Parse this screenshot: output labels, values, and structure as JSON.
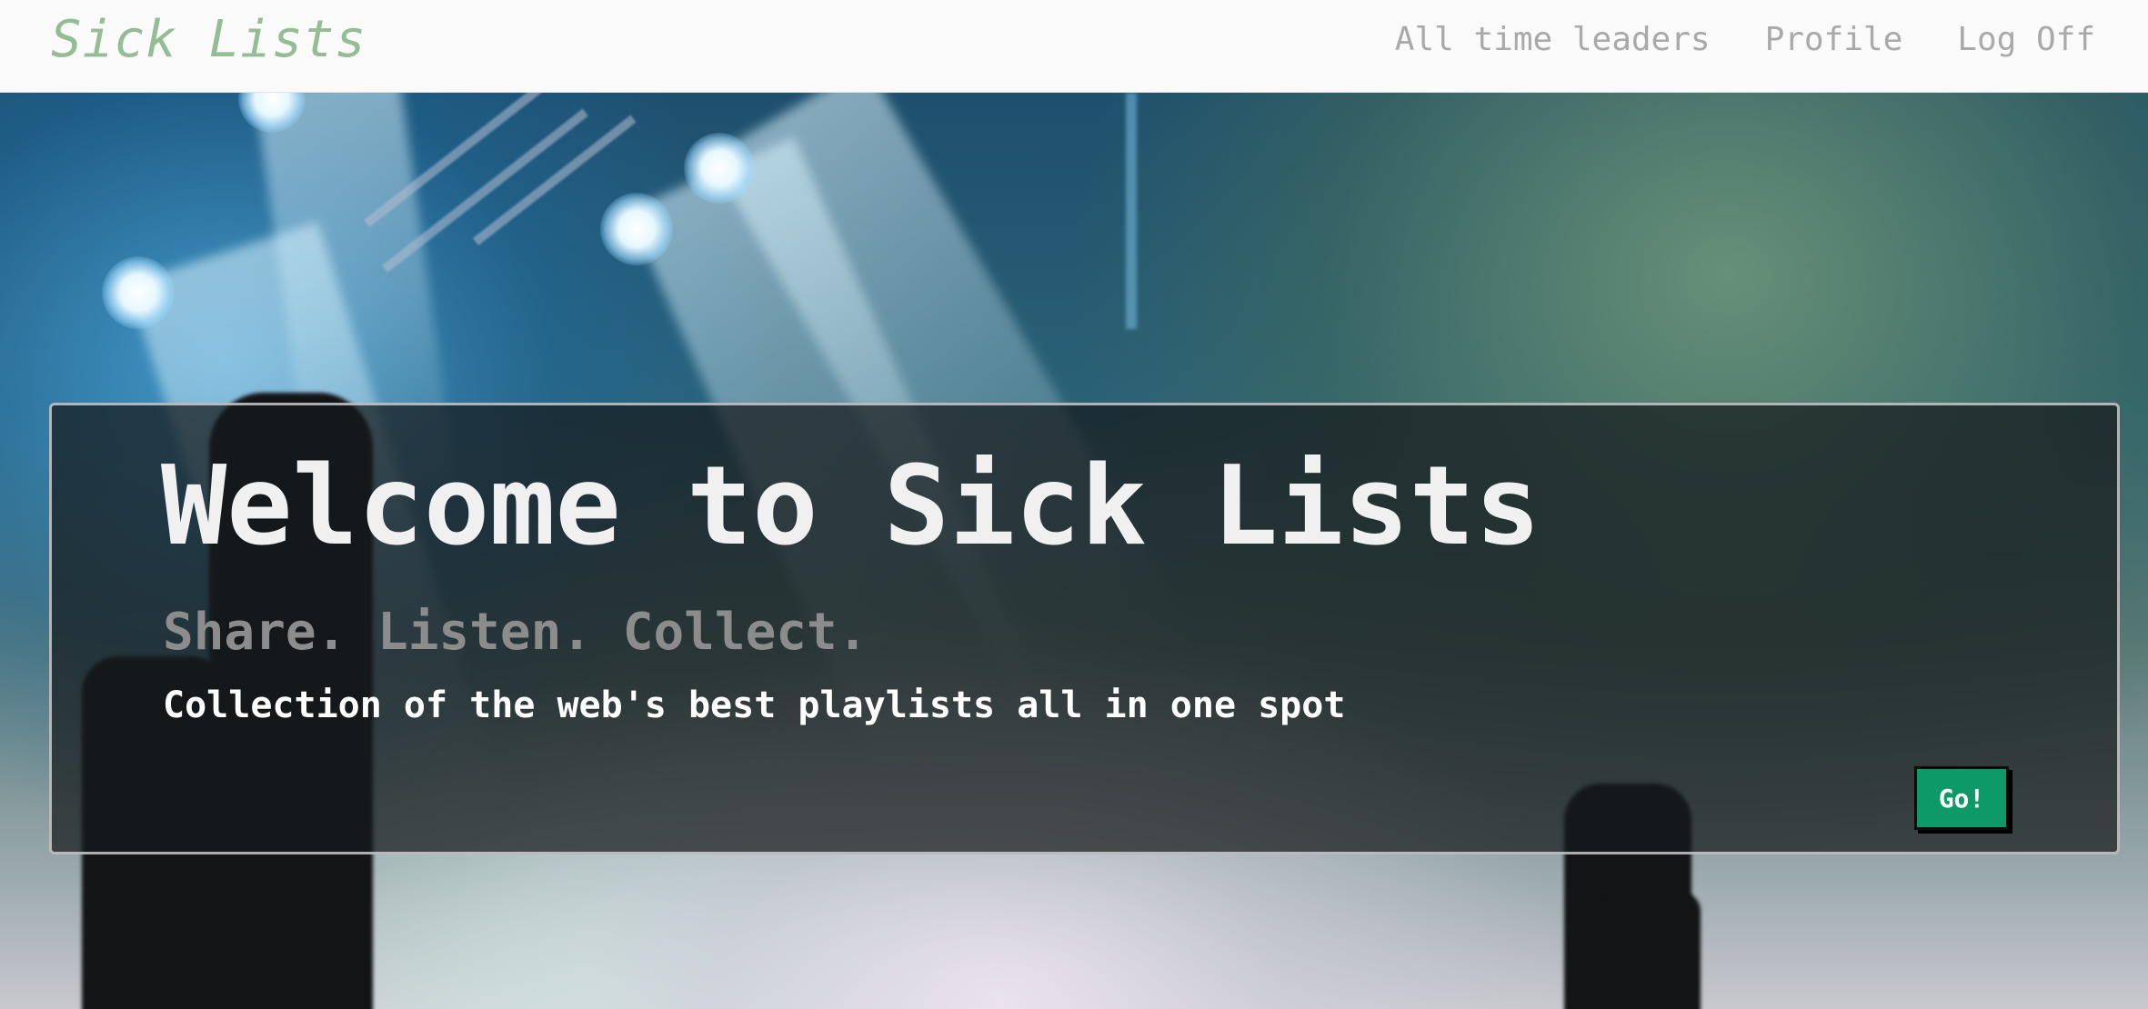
{
  "navbar": {
    "brand": "Sick Lists",
    "links": [
      {
        "label": "All time leaders"
      },
      {
        "label": "Profile"
      },
      {
        "label": "Log Off"
      }
    ]
  },
  "hero": {
    "background_image": "concert-crowd-photo"
  },
  "jumbotron": {
    "title": "Welcome to Sick Lists",
    "subtitle": "Share. Listen. Collect.",
    "description": "Collection of the web's best playlists all in one spot",
    "go_label": "Go!"
  },
  "colors": {
    "brand": "#95bd95",
    "nav_link": "#a9a9a9",
    "go_button": "#0d9a68",
    "jumbotron_bg": "#161a1c"
  }
}
